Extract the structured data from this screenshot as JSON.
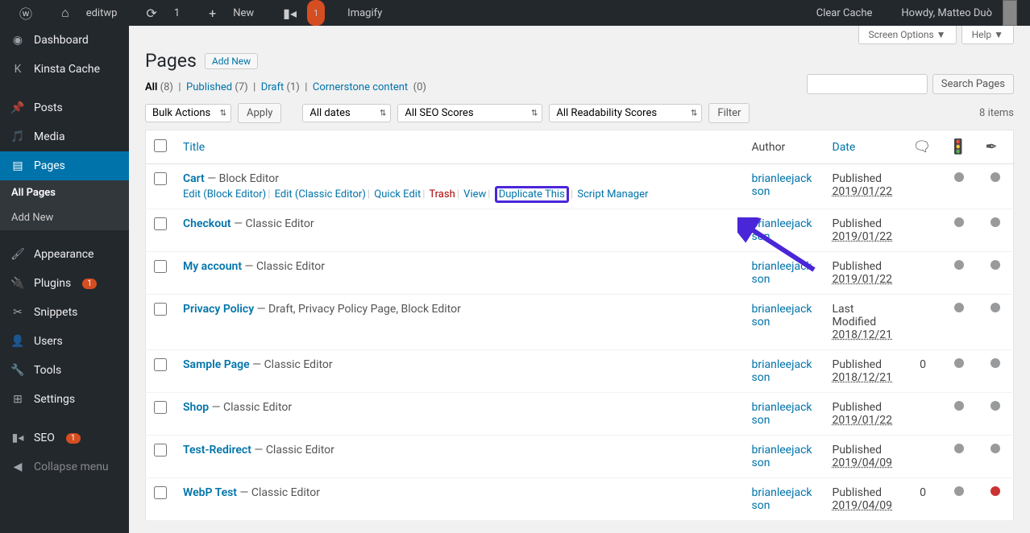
{
  "adminbar": {
    "site_name": "editwp",
    "updates": "1",
    "new_label": "New",
    "imagify": "Imagify",
    "yoast_badge": "1",
    "clear_cache": "Clear Cache",
    "howdy": "Howdy, Matteo Duò"
  },
  "sidebar": {
    "items": [
      {
        "icon": "dashboard",
        "label": "Dashboard"
      },
      {
        "icon": "kinsta",
        "label": "Kinsta Cache"
      },
      {
        "icon": "pin",
        "label": "Posts"
      },
      {
        "icon": "media",
        "label": "Media"
      },
      {
        "icon": "pages",
        "label": "Pages",
        "active": true
      },
      {
        "icon": "appearance",
        "label": "Appearance"
      },
      {
        "icon": "plugins",
        "label": "Plugins",
        "badge": "1"
      },
      {
        "icon": "snippets",
        "label": "Snippets"
      },
      {
        "icon": "users",
        "label": "Users"
      },
      {
        "icon": "tools",
        "label": "Tools"
      },
      {
        "icon": "settings",
        "label": "Settings"
      },
      {
        "icon": "seo",
        "label": "SEO",
        "badge": "1"
      }
    ],
    "submenu": [
      {
        "label": "All Pages",
        "current": true
      },
      {
        "label": "Add New"
      }
    ],
    "collapse": "Collapse menu"
  },
  "screen_meta": {
    "screen_options": "Screen Options ▼",
    "help": "Help ▼"
  },
  "page": {
    "title": "Pages",
    "add_new": "Add New",
    "search_button": "Search Pages",
    "items_count": "8 items"
  },
  "filters": {
    "views": [
      {
        "label": "All",
        "count": "(8)",
        "current": true
      },
      {
        "label": "Published",
        "count": "(7)"
      },
      {
        "label": "Draft",
        "count": "(1)"
      },
      {
        "label": "Cornerstone content",
        "count": "(0)"
      }
    ],
    "bulk_actions": "Bulk Actions",
    "apply": "Apply",
    "all_dates": "All dates",
    "all_seo": "All SEO Scores",
    "all_readability": "All Readability Scores",
    "filter": "Filter"
  },
  "table": {
    "headers": {
      "title": "Title",
      "author": "Author",
      "date": "Date"
    },
    "rows": [
      {
        "title": "Cart",
        "suffix": " — Block Editor",
        "author": "brianleejackson",
        "date_status": "Published",
        "date": "2019/01/22",
        "comments": "",
        "seo": "dot",
        "read": "dot",
        "show_actions": true
      },
      {
        "title": "Checkout",
        "suffix": " — Classic Editor",
        "author": "brianleejackson",
        "date_status": "Published",
        "date": "2019/01/22",
        "comments": "",
        "seo": "dot",
        "read": "dot"
      },
      {
        "title": "My account",
        "suffix": " — Classic Editor",
        "author": "brianleejackson",
        "date_status": "Published",
        "date": "2019/01/22",
        "comments": "",
        "seo": "dot",
        "read": "dot"
      },
      {
        "title": "Privacy Policy",
        "suffix": " — Draft, Privacy Policy Page, Block Editor",
        "author": "brianleejackson",
        "date_status": "Last Modified",
        "date": "2018/12/21",
        "comments": "",
        "seo": "dot",
        "read": "dot"
      },
      {
        "title": "Sample Page",
        "suffix": " — Classic Editor",
        "author": "brianleejackson",
        "date_status": "Published",
        "date": "2018/12/21",
        "comments": "0",
        "seo": "dot",
        "read": "dot"
      },
      {
        "title": "Shop",
        "suffix": " — Classic Editor",
        "author": "brianleejackson",
        "date_status": "Published",
        "date": "2019/01/22",
        "comments": "",
        "seo": "dot",
        "read": "dot"
      },
      {
        "title": "Test-Redirect",
        "suffix": " — Classic Editor",
        "author": "brianleejackson",
        "date_status": "Published",
        "date": "2019/04/09",
        "comments": "",
        "seo": "dot",
        "read": "dot"
      },
      {
        "title": "WebP Test",
        "suffix": " — Classic Editor",
        "author": "brianleejackson",
        "date_status": "Published",
        "date": "2019/04/09",
        "comments": "0",
        "seo": "dot",
        "read": "red"
      }
    ],
    "row_actions": {
      "edit_block": "Edit (Block Editor)",
      "edit_classic": "Edit (Classic Editor)",
      "quick_edit": "Quick Edit",
      "trash": "Trash",
      "view": "View",
      "duplicate": "Duplicate This",
      "script_mgr": "Script Manager"
    }
  }
}
